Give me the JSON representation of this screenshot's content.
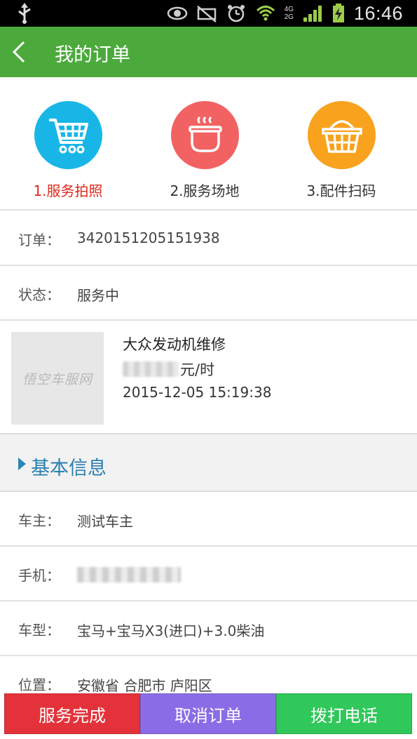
{
  "status_bar": {
    "time": "16:46",
    "network_top": "4G",
    "network_bottom": "2G",
    "icons": [
      "usb-icon",
      "eye-icon",
      "mute-icon",
      "alarm-icon",
      "wifi-icon",
      "signal-icon",
      "battery-icon"
    ]
  },
  "header": {
    "title": "我的订单",
    "background": "#4caa3d"
  },
  "steps": [
    {
      "label": "1.服务拍照",
      "color": "#18b6e6",
      "icon": "cart-icon",
      "active": true
    },
    {
      "label": "2.服务场地",
      "color": "#f36262",
      "icon": "bowl-icon",
      "active": false
    },
    {
      "label": "3.配件扫码",
      "color": "#f8a21e",
      "icon": "basket-icon",
      "active": false
    }
  ],
  "order": {
    "number_label": "订单：",
    "number": "3420151205151938",
    "status_label": "状态：",
    "status": "服务中"
  },
  "product": {
    "thumb_logo": "悟空车服网",
    "name": "大众发动机维修",
    "price_suffix": "元/时",
    "time": "2015-12-05 15:19:38"
  },
  "section": {
    "title": "基本信息",
    "accent": "#2a7fb0"
  },
  "info": {
    "owner_label": "车主：",
    "owner": "测试车主",
    "phone_label": "手机：",
    "model_label": "车型：",
    "model": "宝马+宝马X3(进口)+3.0柴油",
    "location_label": "位置：",
    "location": "安徽省 合肥市 庐阳区"
  },
  "actions": [
    {
      "label": "服务完成",
      "color": "#e3323a"
    },
    {
      "label": "取消订单",
      "color": "#8a6de6"
    },
    {
      "label": "拨打电话",
      "color": "#30c85a"
    }
  ]
}
